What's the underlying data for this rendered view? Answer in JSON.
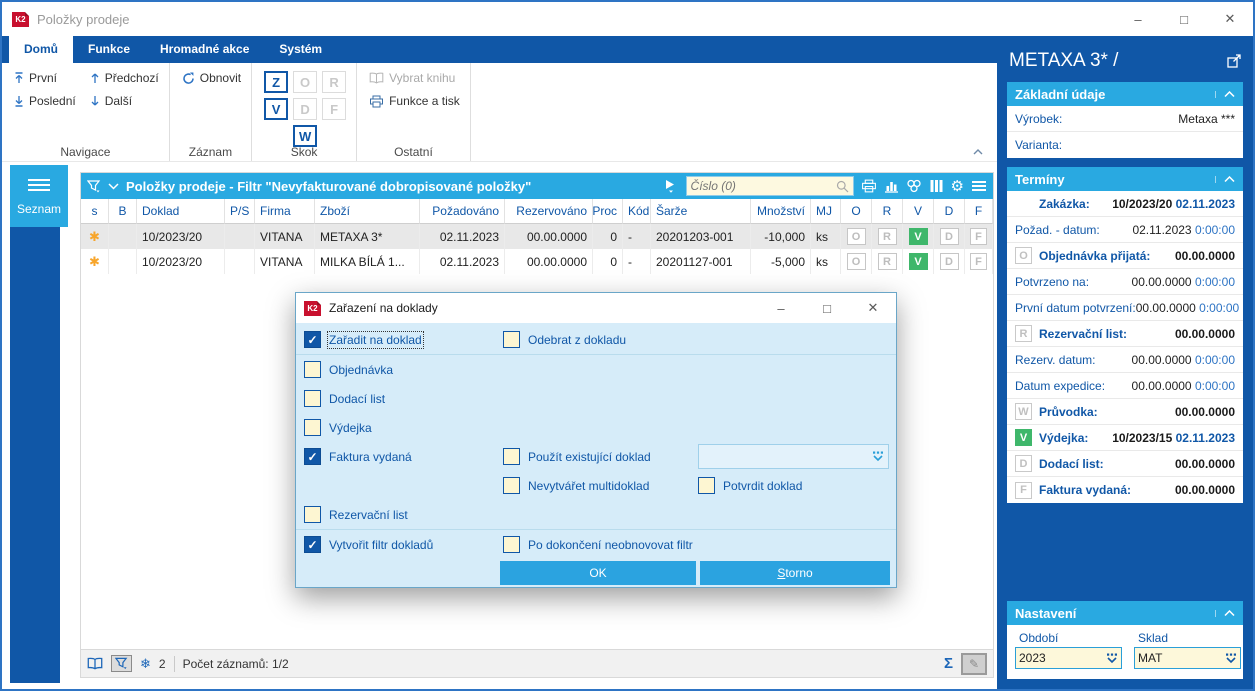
{
  "icons": {
    "minimize": "–",
    "maximize": "□",
    "close": "✕",
    "gear": "⚙",
    "sigma": "Σ",
    "snowflake": "❄",
    "asterisk": "✱",
    "pencil": "✎"
  },
  "window": {
    "title": "Položky prodeje",
    "logo": "K2"
  },
  "ribbon": {
    "tabs": [
      {
        "label": "Domů"
      },
      {
        "label": "Funkce"
      },
      {
        "label": "Hromadné akce"
      },
      {
        "label": "Systém"
      }
    ],
    "navigace": {
      "label": "Navigace",
      "first": "První",
      "last": "Poslední",
      "prev": "Předchozí",
      "next": "Další"
    },
    "zaznam": {
      "label": "Záznam",
      "refresh": "Obnovit"
    },
    "skok": {
      "label": "Skok",
      "letters": {
        "z": "Z",
        "o": "O",
        "r": "R",
        "v": "V",
        "d": "D",
        "f": "F",
        "w": "W"
      },
      "active": {
        "z": true,
        "o": false,
        "r": false,
        "v": true,
        "d": false,
        "f": false,
        "w": true
      }
    },
    "ostatni": {
      "label": "Ostatní",
      "select_book": "Vybrat knihu",
      "print": "Funkce a tisk"
    }
  },
  "nav_panel": {
    "tab_label": "Seznam"
  },
  "browse": {
    "title": "Položky prodeje - Filtr \"Nevyfakturované dobropisované položky\"",
    "search_placeholder": "Číslo (0)"
  },
  "table": {
    "columns": [
      "s",
      "B",
      "Doklad",
      "P/S",
      "Firma",
      "Zboží",
      "Požadováno",
      "Rezervováno",
      "Proc",
      "Kód",
      "Šarže",
      "Množství",
      "MJ",
      "O",
      "R",
      "V",
      "D",
      "F"
    ],
    "rows": [
      {
        "doklad": "10/2023/20",
        "ps": "",
        "firma": "VITANA",
        "zbozi": "METAXA 3*",
        "pozadovano": "02.11.2023",
        "rezervovano": "00.00.0000",
        "proc": "0",
        "kod": "-",
        "sarze": "20201203-001",
        "mnozstvi": "-10,000",
        "mj": "ks",
        "selected": true,
        "badges": {
          "O": false,
          "R": false,
          "V": true,
          "D": false,
          "F": false
        }
      },
      {
        "doklad": "10/2023/20",
        "ps": "",
        "firma": "VITANA",
        "zbozi": "MILKA BÍLÁ 1...",
        "pozadovano": "02.11.2023",
        "rezervovano": "00.00.0000",
        "proc": "0",
        "kod": "-",
        "sarze": "20201127-001",
        "mnozstvi": "-5,000",
        "mj": "ks",
        "selected": false,
        "badges": {
          "O": false,
          "R": false,
          "V": true,
          "D": false,
          "F": false
        }
      }
    ]
  },
  "statusbar": {
    "flake_count": "2",
    "records": "Počet záznamů: 1/2"
  },
  "dialog": {
    "title": "Zařazení na doklady",
    "checks": {
      "zaradit": {
        "label": "Zařadit na doklad",
        "checked": true
      },
      "odebrat": {
        "label": "Odebrat z dokladu",
        "checked": false
      },
      "objednavka": {
        "label": "Objednávka",
        "checked": false
      },
      "dodaci": {
        "label": "Dodací list",
        "checked": false
      },
      "vydejka": {
        "label": "Výdejka",
        "checked": false
      },
      "faktura": {
        "label": "Faktura vydaná",
        "checked": true
      },
      "pouzit": {
        "label": "Použít existující doklad",
        "checked": false
      },
      "multidoklad": {
        "label": "Nevytvářet multidoklad",
        "checked": false
      },
      "potvrdit": {
        "label": "Potvrdit doklad",
        "checked": false
      },
      "rezervacni": {
        "label": "Rezervační list",
        "checked": false
      },
      "filtr": {
        "label": "Vytvořit filtr dokladů",
        "checked": true
      },
      "neobnovovat": {
        "label": "Po dokončení neobnovovat filtr",
        "checked": false
      }
    },
    "combo_value": "",
    "ok": "OK",
    "storno": "Storno"
  },
  "sidebar": {
    "title": "METAXA 3* /",
    "zakladni": {
      "header": "Základní údaje",
      "vyrobek_label": "Výrobek:",
      "vyrobek_value": "Metaxa ***",
      "varianta_label": "Varianta:",
      "varianta_value": ""
    },
    "terminy": {
      "header": "Termíny",
      "rows": [
        {
          "label": "Zakázka:",
          "v1": "10/2023/20",
          "v2": "02.11.2023",
          "badge": "",
          "badge_on": false
        },
        {
          "label": "Požad. - datum:",
          "v1": "02.11.2023",
          "v2": "0:00:00"
        },
        {
          "label": "Objednávka přijatá:",
          "v1": "00.00.0000",
          "v2": "",
          "badge": "O",
          "badge_on": false
        },
        {
          "label": "Potvrzeno na:",
          "v1": "00.00.0000",
          "v2": "0:00:00"
        },
        {
          "label": "První datum potvrzení:",
          "v1": "00.00.0000",
          "v2": "0:00:00"
        },
        {
          "label": "Rezervační list:",
          "v1": "00.00.0000",
          "v2": "",
          "badge": "R",
          "badge_on": false
        },
        {
          "label": "Rezerv. datum:",
          "v1": "00.00.0000",
          "v2": "0:00:00"
        },
        {
          "label": "Datum expedice:",
          "v1": "00.00.0000",
          "v2": "0:00:00"
        },
        {
          "label": "Průvodka:",
          "v1": "00.00.0000",
          "v2": "",
          "badge": "W",
          "badge_on": false
        },
        {
          "label": "Výdejka:",
          "v1": "10/2023/15",
          "v2": "02.11.2023",
          "badge": "V",
          "badge_on": true
        },
        {
          "label": "Dodací list:",
          "v1": "00.00.0000",
          "v2": "",
          "badge": "D",
          "badge_on": false
        },
        {
          "label": "Faktura vydaná:",
          "v1": "00.00.0000",
          "v2": "",
          "badge": "F",
          "badge_on": false
        }
      ]
    },
    "nastaveni": {
      "header": "Nastavení",
      "obdobi_label": "Období",
      "obdobi_value": "2023",
      "sklad_label": "Sklad",
      "sklad_value": "MAT"
    }
  }
}
